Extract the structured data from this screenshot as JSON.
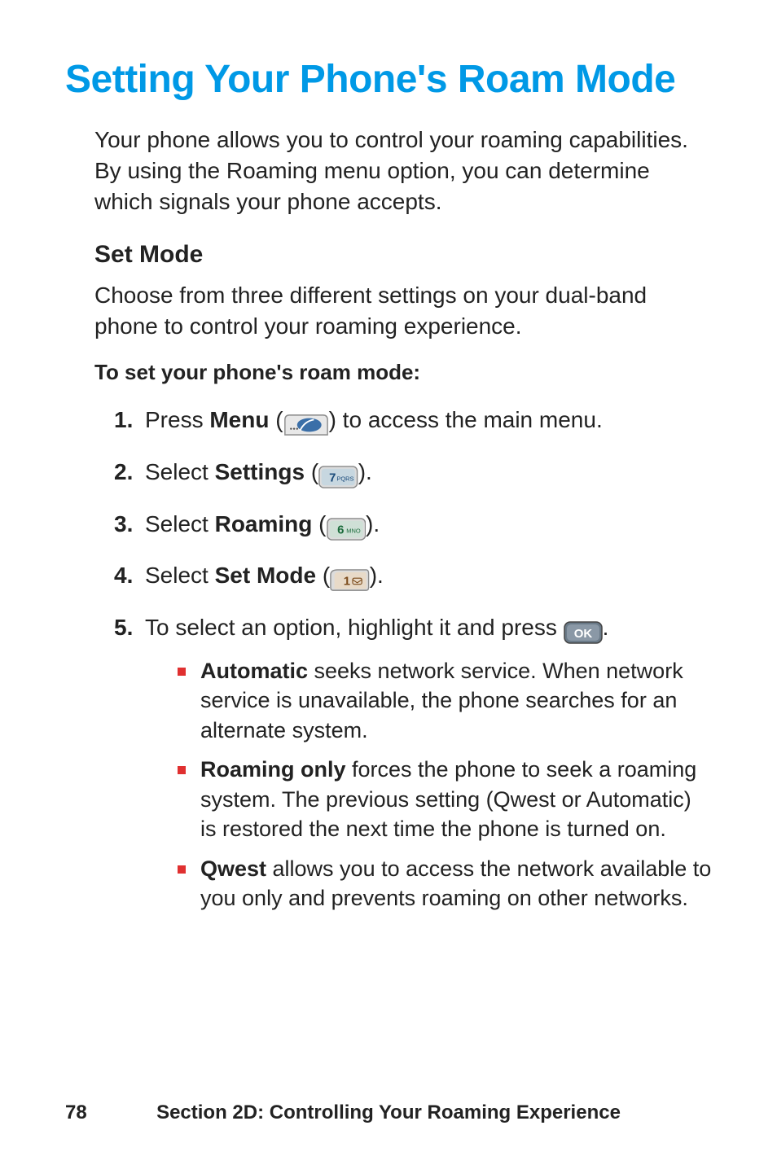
{
  "heading": "Setting Your Phone's Roam Mode",
  "intro": "Your phone allows you to control your roaming capabilities. By using the Roaming menu option, you can determine which signals your phone accepts.",
  "subheading": "Set Mode",
  "subintro": "Choose from three different settings on your dual-band phone to control your roaming experience.",
  "proc_heading": "To set your phone's roam mode:",
  "steps": {
    "s1": {
      "num": "1.",
      "pre": "Press ",
      "bold": "Menu",
      "post_a": " (",
      "post_b": ") to access the main menu."
    },
    "s2": {
      "num": "2.",
      "pre": "Select ",
      "bold": "Settings",
      "post_a": " (",
      "post_b": ")."
    },
    "s3": {
      "num": "3.",
      "pre": "Select ",
      "bold": "Roaming",
      "post_a": " (",
      "post_b": ")."
    },
    "s4": {
      "num": "4.",
      "pre": "Select ",
      "bold": "Set Mode",
      "post_a": " (",
      "post_b": ")."
    },
    "s5": {
      "num": "5.",
      "pre": "To select an option, highlight it and press ",
      "post": "."
    }
  },
  "bullets": {
    "b1": {
      "bold": "Automatic",
      "rest": " seeks network service. When network service is unavailable, the phone searches for an alternate system."
    },
    "b2": {
      "bold": "Roaming only",
      "rest": " forces the phone to seek a roaming system. The previous setting (Qwest or Automatic) is restored the next time the phone is turned on."
    },
    "b3": {
      "bold": "Qwest",
      "rest": " allows you to access the network available to you only and prevents roaming on other networks."
    }
  },
  "footer": {
    "page": "78",
    "section": "Section 2D: Controlling Your Roaming Experience"
  },
  "icons": {
    "menu": "menu-softkey-icon",
    "key7": "7-pqrs-key-icon",
    "key6": "6-mno-key-icon",
    "key1": "1-key-icon",
    "ok": "ok-key-icon"
  }
}
